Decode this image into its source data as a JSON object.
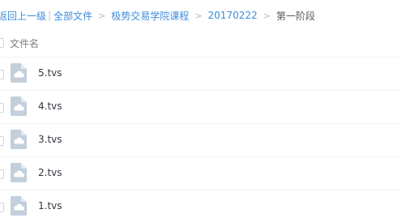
{
  "breadcrumb": {
    "back": "返回上一级",
    "bar": "|",
    "arrow": ">",
    "items": [
      "全部文件",
      "极势交易学院课程",
      "20170222"
    ],
    "current": "第一阶段"
  },
  "file_list": {
    "header": "文件名",
    "files": [
      {
        "name": "5.tvs",
        "icon": "video-file-icon"
      },
      {
        "name": "4.tvs",
        "icon": "video-file-icon"
      },
      {
        "name": "3.tvs",
        "icon": "video-file-icon"
      },
      {
        "name": "2.tvs",
        "icon": "video-file-icon"
      },
      {
        "name": "1.tvs",
        "icon": "video-file-icon"
      }
    ]
  },
  "colors": {
    "link": "#3b8cdc",
    "icon": "#c3cfdb",
    "divider": "#f0f2f4"
  }
}
